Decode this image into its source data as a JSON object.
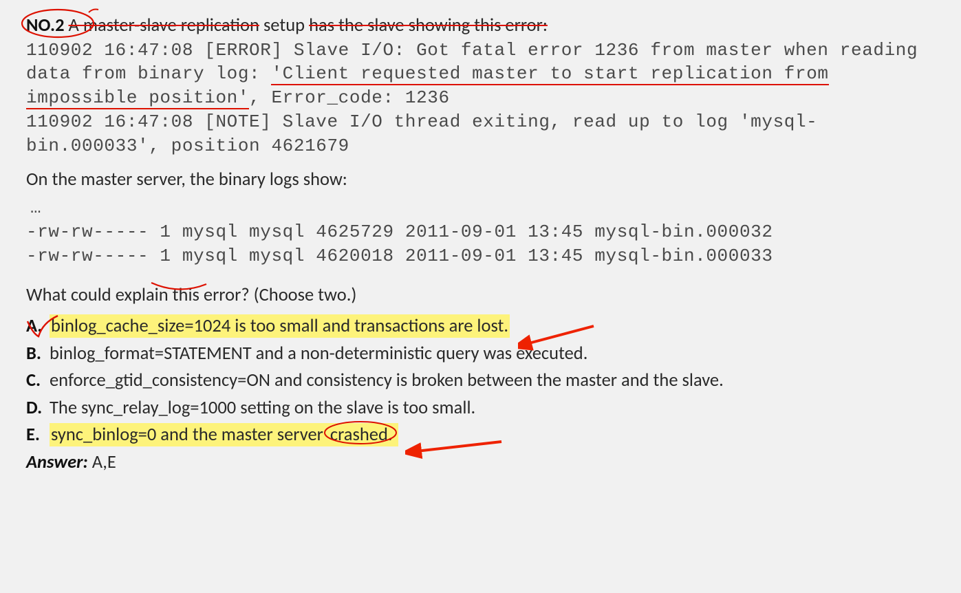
{
  "question": {
    "number_label": "NO.2",
    "intro_part1": "A master-slave replication",
    "intro_part2": " setup ",
    "intro_part3": "has the slave showing this error:",
    "error_log_line1a": "110902 16:47:08 [ERROR] Slave I/O: Got fatal error 1236 from master when reading data from binary log: ",
    "error_log_line1b": "'Client requested master to start replication from impossible position'",
    "error_log_line1c": ", Error_code: 1236",
    "error_log_line2": "110902 16:47:08 [NOTE] Slave I/O thread exiting, read up to log 'mysql-bin.000033', position 4621679",
    "binlog_intro": "On the master server, the binary logs show:",
    "ellipsis": "…",
    "ls_line1": "-rw-rw-----  1 mysql mysql 4625729 2011-09-01 13:45 mysql-bin.000032",
    "ls_line2": "-rw-rw-----  1 mysql mysql 4620018 2011-09-01 13:45 mysql-bin.000033",
    "prompt": "What could explain this error? (Choose two.)",
    "options": {
      "A": {
        "label": "A.",
        "text": "binlog_cache_size=1024 is too small and transactions are lost."
      },
      "B": {
        "label": "B.",
        "text": "binlog_format=STATEMENT and a non-deterministic query was executed."
      },
      "C": {
        "label": "C.",
        "text": "enforce_gtid_consistency=ON and consistency is broken between the master and the slave."
      },
      "D": {
        "label": "D.",
        "text": "The sync_relay_log=1000 setting on the slave is too small."
      },
      "E": {
        "label": "E.",
        "text_a": "sync_binlog=0 and the master server ",
        "text_b": "crashed."
      }
    },
    "answer_label": "Answer:",
    "answer_value": "A,E"
  },
  "annotation_color": "#d10"
}
